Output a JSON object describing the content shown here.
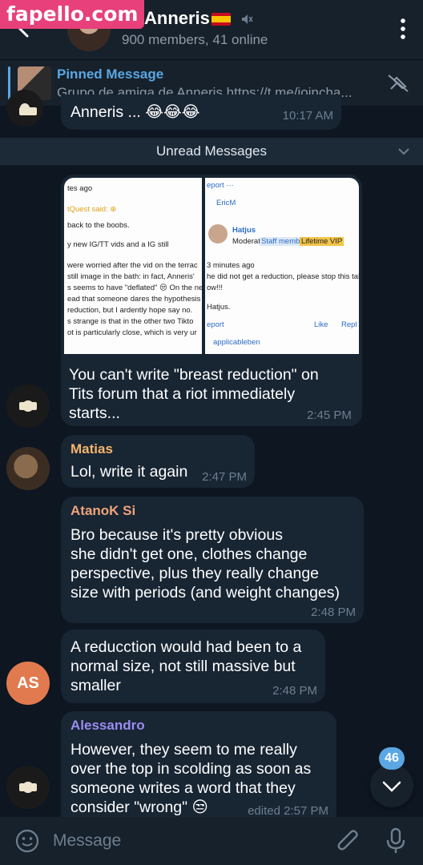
{
  "watermark": "fapello.com",
  "header": {
    "title": "Anneris",
    "subtitle": "900 members, 41 online"
  },
  "pinned": {
    "title": "Pinned Message",
    "text": "Grupo de amiga de Anneris  https://t.me/joincha..."
  },
  "partial_message": {
    "text": "Anneris ... 😂😂😂",
    "time": "10:17 AM"
  },
  "unread_label": "Unread Messages",
  "screenshot_left": {
    "lines": [
      "tes ago",
      "tQuest said: ⊕",
      "back to the boobs.",
      "y new IG/TT vids and a IG still",
      "were worried after the vid on the terrac",
      "still image in the bath: in fact, Anneris'",
      "s seems to have \"deflated\" 😒 On the ne",
      "ead that someone dares the hypothesis",
      "reduction, but I ardently hope say no.",
      "s strange is that in the other two Tikto",
      "ot is particularly close, which is very ur"
    ]
  },
  "screenshot_right": {
    "lines": [
      "eport  ···",
      "EricM",
      "Hatjus",
      "Moderator",
      "Staff member",
      "Lifetime VIP",
      "3 minutes ago",
      "he did not get a reduction, please stop this talk",
      "ow!!!",
      "Hatjus.",
      "eport",
      "Like",
      "Repl",
      "applicableben"
    ]
  },
  "messages": [
    {
      "sender": "",
      "lines": [
        "You can't write \"breast reduction\" on",
        "Tits forum that a riot immediately",
        "starts..."
      ],
      "time": "2:45 PM"
    },
    {
      "sender": "Matias",
      "sender_color": "#f5b56b",
      "lines": [
        "Lol, write it again"
      ],
      "time": "2:47 PM"
    },
    {
      "sender": "AtanoK Si",
      "sender_color": "#f0a37b",
      "lines": [
        "Bro because it's pretty obvious",
        "she didn't get one, clothes change",
        "perspective, plus they really change",
        "size with periods (and weight changes)"
      ],
      "time": "2:48 PM"
    },
    {
      "sender": "",
      "avatar_initials": "AS",
      "lines": [
        "A reducction would had been to a",
        "normal size, not still massive but",
        "smaller"
      ],
      "time": "2:48 PM"
    },
    {
      "sender": "Alessandro",
      "sender_color": "#9b8cf0",
      "lines": [
        "However, they seem to me really",
        "over the top in scolding as soon as",
        "someone writes a word that they",
        "consider \"wrong\" 😒"
      ],
      "time": "edited 2:57 PM"
    }
  ],
  "unread_count": "46",
  "composer": {
    "placeholder": "Message"
  },
  "colors": {
    "background": "#0e1621",
    "bubble": "#182533",
    "accent": "#5aa7e4"
  }
}
